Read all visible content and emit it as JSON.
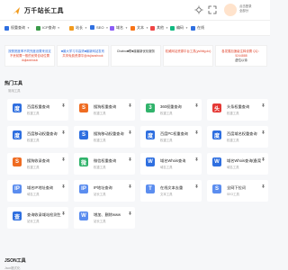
{
  "header": {
    "brand": "万千站长工具",
    "login_line1": "点击登录",
    "login_line2": "全部分"
  },
  "nav": [
    {
      "label": "权重查询",
      "color": "#2f6fe0"
    },
    {
      "label": "ICP查询",
      "color": "#3c9b4a"
    },
    {
      "label": "站长",
      "color": "#f29b1d"
    },
    {
      "label": "SEO",
      "color": "#2f6fe0"
    },
    {
      "label": "域名",
      "color": "#8b5cf6"
    },
    {
      "label": "文本",
      "color": "#f97316"
    },
    {
      "label": "其他",
      "color": "#ef4444"
    },
    {
      "label": "编码",
      "color": "#10b981"
    },
    {
      "label": "在线",
      "color": "#2f6fe0"
    }
  ],
  "ads": [
    {
      "l1": "按照宽度率不同完度设置来设定",
      "l2": "不丢前置一般的优势自动位置",
      "l3": "dujiaoshouk"
    },
    {
      "l1": "■最大学习平高清■最新网站发布",
      "l2": "共享免费资源平台dujiaoshouk",
      "l3": ""
    },
    {
      "l1": "Chatno■联■接最新优化服务",
      "l2": "",
      "l3": ""
    },
    {
      "l1": "权威网站资源平台工具(ysihttg.do)",
      "l2": "",
      "l3": ""
    },
    {
      "l1": "各发展加速级注释设置 QQ：5244888",
      "l2": "虚位以待",
      "l3": ""
    }
  ],
  "hot": {
    "title": "热门工具",
    "subtitle": "常用工具"
  },
  "tools": [
    {
      "name": "百度权重查询",
      "cat": "权重工具",
      "icon": "度",
      "color": "#2f6fe0"
    },
    {
      "name": "搜狗权重查询",
      "cat": "权重工具",
      "icon": "S",
      "color": "#ef6c22"
    },
    {
      "name": "360权重查询",
      "cat": "权重工具",
      "icon": "3",
      "color": "#31b36b"
    },
    {
      "name": "头条权重查询",
      "cat": "权重工具",
      "icon": "头",
      "color": "#e53935"
    },
    {
      "name": "百度移动权重查询",
      "cat": "权重工具",
      "icon": "度",
      "color": "#2f6fe0"
    },
    {
      "name": "搜狗移动权重查询",
      "cat": "权重工具",
      "icon": "S",
      "color": "#2f6fe0"
    },
    {
      "name": "百度PC权重查询",
      "cat": "权重工具",
      "icon": "度",
      "color": "#2f6fe0"
    },
    {
      "name": "百度域名权重查询",
      "cat": "权重工具",
      "icon": "度",
      "color": "#2f6fe0"
    },
    {
      "name": "搜狗收录查询",
      "cat": "权重工具",
      "icon": "S",
      "color": "#ef6c22"
    },
    {
      "name": "微信权重查询",
      "cat": "权重工具",
      "icon": "微",
      "color": "#31b36b"
    },
    {
      "name": "域名Whois查询",
      "cat": "域名工具",
      "icon": "W",
      "color": "#2f6fe0"
    },
    {
      "name": "域名Whois查询(备案)",
      "cat": "域名工具",
      "icon": "W",
      "color": "#2f6fe0"
    },
    {
      "name": "域名IP地址查询",
      "cat": "域名工具",
      "icon": "IP",
      "color": "#5b8def"
    },
    {
      "name": "IP地址查询",
      "cat": "站长工具",
      "icon": "IP",
      "color": "#5b8def"
    },
    {
      "name": "在线文本去重",
      "cat": "文本工具",
      "icon": "T",
      "color": "#5b8def"
    },
    {
      "name": "全网下拉词",
      "cat": "SEO工具",
      "icon": "S",
      "color": "#5b8def"
    },
    {
      "name": "查询收录域站检测生成",
      "cat": "站长工具",
      "icon": "查",
      "color": "#2f6fe0"
    },
    {
      "name": "增加、删除www",
      "cat": "站长工具",
      "icon": "W",
      "color": "#5b8def"
    }
  ],
  "json_section": {
    "title": "JSON工具",
    "subtitle": "Json格式化"
  }
}
